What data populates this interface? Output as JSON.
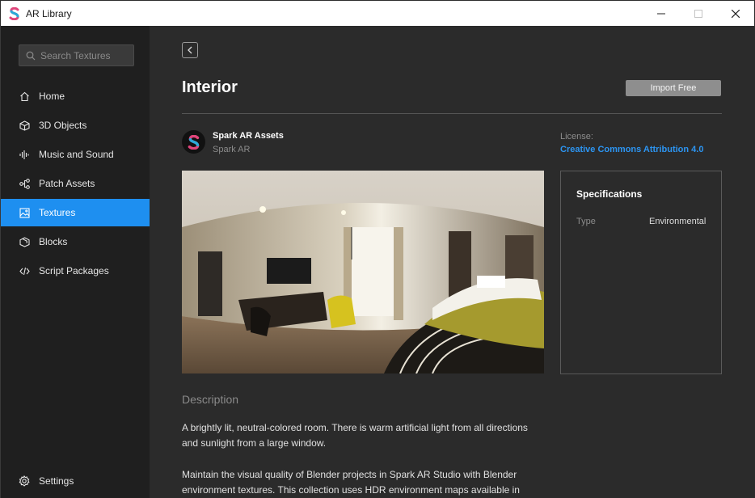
{
  "window": {
    "title": "AR Library",
    "minimize": "—",
    "maximize": "☐",
    "close": "✕"
  },
  "sidebar": {
    "search_placeholder": "Search Textures",
    "items": [
      {
        "label": "Home",
        "icon": "home-icon"
      },
      {
        "label": "3D Objects",
        "icon": "cube-icon"
      },
      {
        "label": "Music and Sound",
        "icon": "waveform-icon"
      },
      {
        "label": "Patch Assets",
        "icon": "patch-icon"
      },
      {
        "label": "Textures",
        "icon": "image-icon",
        "active": true
      },
      {
        "label": "Blocks",
        "icon": "blocks-icon"
      },
      {
        "label": "Script Packages",
        "icon": "code-icon"
      }
    ],
    "settings_label": "Settings"
  },
  "page": {
    "title": "Interior",
    "import_label": "Import Free",
    "author": {
      "name": "Spark AR Assets",
      "subtitle": "Spark AR"
    },
    "license": {
      "label": "License:",
      "value": "Creative Commons Attribution 4.0"
    },
    "specs": {
      "title": "Specifications",
      "rows": [
        {
          "key": "Type",
          "value": "Environmental"
        }
      ]
    },
    "description": {
      "heading": "Description",
      "paragraphs": [
        "A brightly lit, neutral-colored room. There is warm artificial light from all directions and sunlight from a large window.",
        "Maintain the visual quality of Blender projects in Spark AR Studio with Blender environment textures. This collection uses HDR environment maps available in"
      ]
    }
  },
  "colors": {
    "accent": "#1e8ff0",
    "link": "#2c95f2",
    "sidebar_bg": "#1f1f1f",
    "main_bg": "#2b2b2b"
  }
}
